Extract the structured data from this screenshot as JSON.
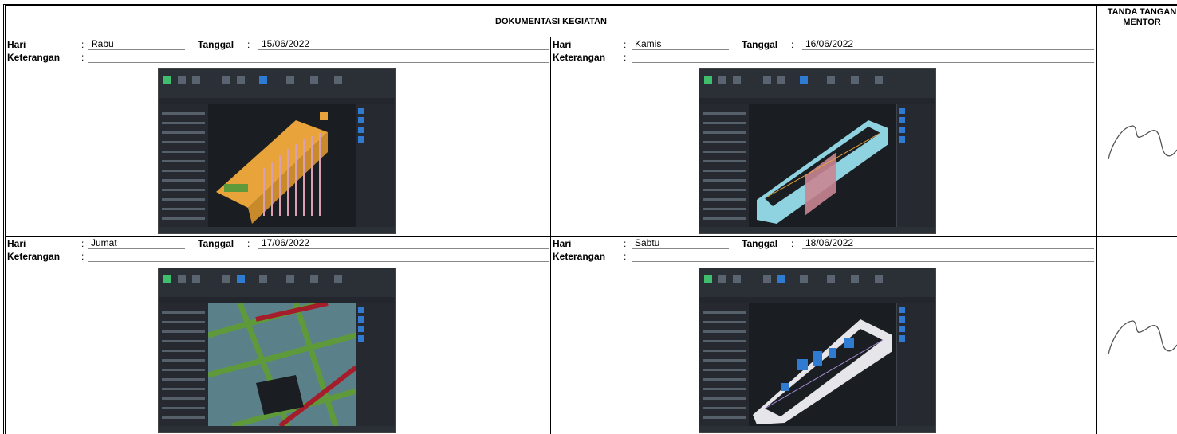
{
  "header": {
    "title": "DOKUMENTASI KEGIATAN",
    "signature_title_line1": "TANDA TANGAN",
    "signature_title_line2": "MENTOR"
  },
  "labels": {
    "hari": "Hari",
    "tanggal": "Tanggal",
    "keterangan": "Keterangan",
    "colon": ":"
  },
  "entries": [
    {
      "hari": "Rabu",
      "tanggal": "15/06/2022",
      "keterangan": ""
    },
    {
      "hari": "Kamis",
      "tanggal": "16/06/2022",
      "keterangan": ""
    },
    {
      "hari": "Jumat",
      "tanggal": "17/06/2022",
      "keterangan": ""
    },
    {
      "hari": "Sabtu",
      "tanggal": "18/06/2022",
      "keterangan": ""
    }
  ],
  "colors": {
    "border": "#000000",
    "app_bg": "#1e2227",
    "accent_blue": "#2f7bd1",
    "model_orange": "#e8a33a",
    "model_cyan": "#8fd3e0",
    "model_green": "#5f9a3a",
    "model_red": "#a51c2a",
    "model_pink": "#d9a0b4"
  }
}
